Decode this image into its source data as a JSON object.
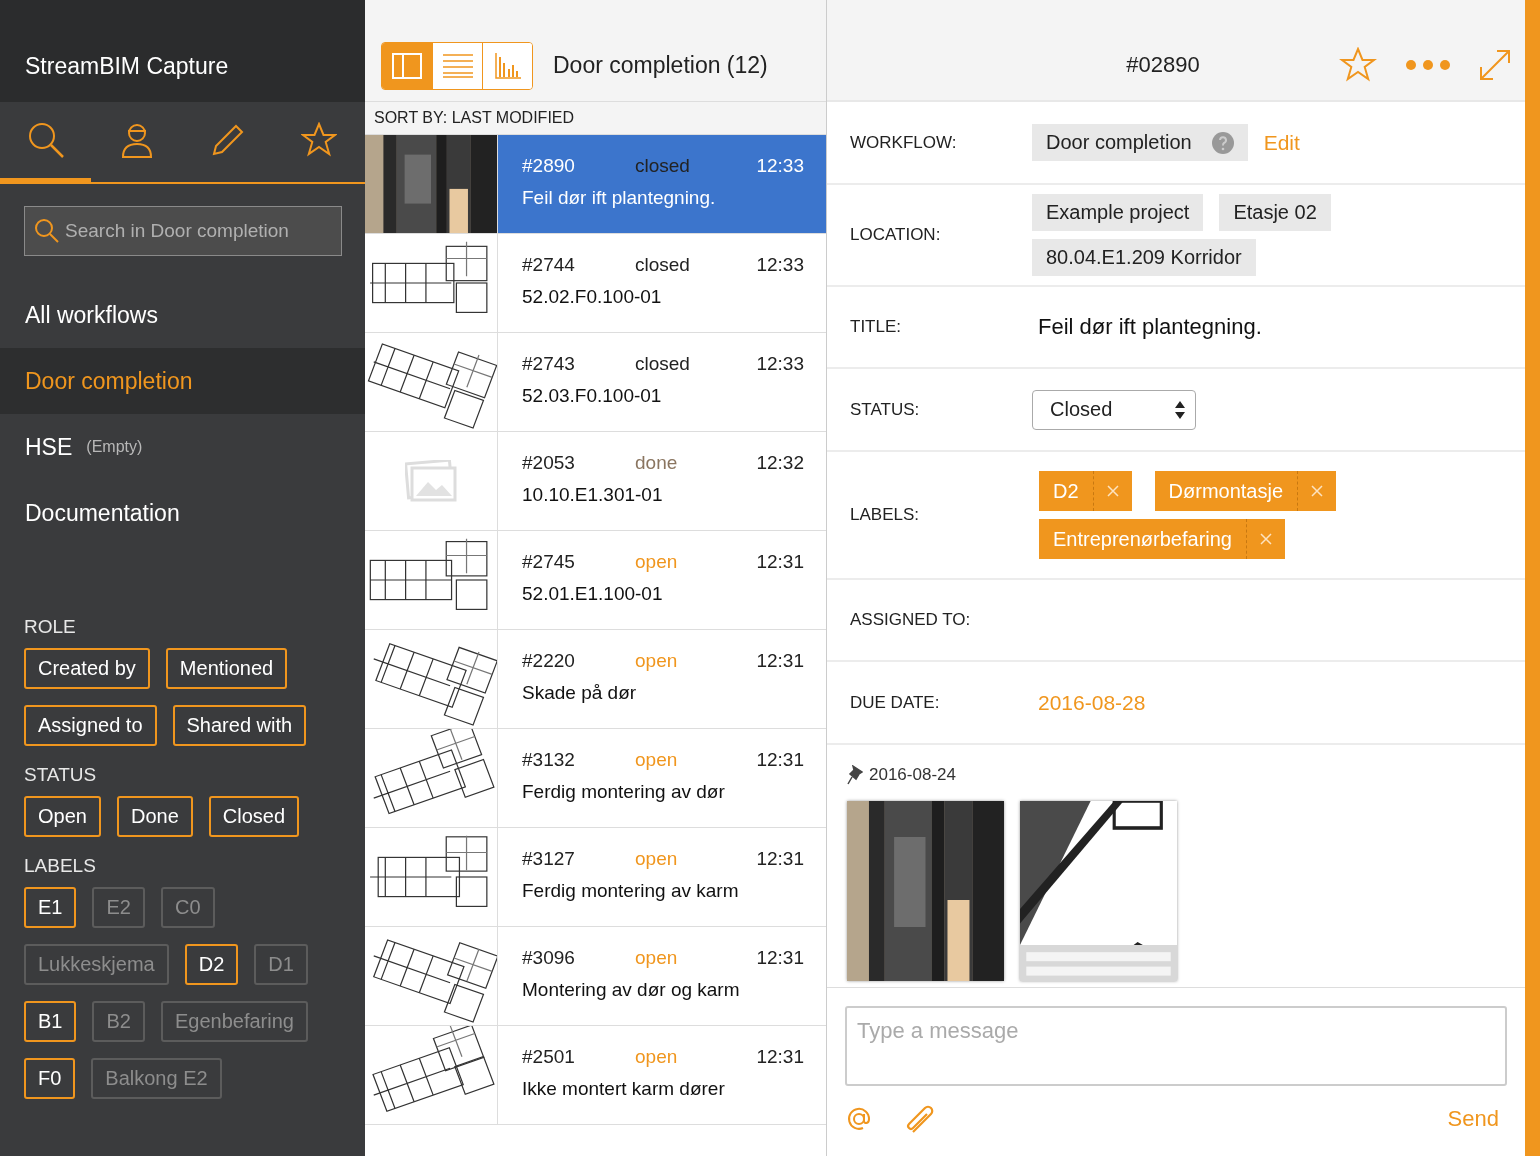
{
  "sidebar": {
    "title": "StreamBIM Capture",
    "tabs": [
      {
        "kind": "search",
        "selected": true
      },
      {
        "kind": "person",
        "selected": false
      },
      {
        "kind": "pencil",
        "selected": false
      },
      {
        "kind": "star",
        "selected": false
      }
    ],
    "search": {
      "placeholder": "Search in Door completion"
    },
    "workflows": [
      {
        "label": "All workflows",
        "selected": false
      },
      {
        "label": "Door completion",
        "selected": true
      },
      {
        "label": "HSE",
        "note": "(Empty)",
        "selected": false
      },
      {
        "label": "Documentation",
        "selected": false
      }
    ],
    "filters": [
      {
        "heading": "ROLE",
        "chips": [
          {
            "label": "Created by",
            "selected": true
          },
          {
            "label": "Mentioned",
            "selected": true
          },
          {
            "label": "Assigned to",
            "selected": true
          },
          {
            "label": "Shared with",
            "selected": true
          }
        ]
      },
      {
        "heading": "STATUS",
        "chips": [
          {
            "label": "Open",
            "selected": true
          },
          {
            "label": "Done",
            "selected": true
          },
          {
            "label": "Closed",
            "selected": true
          }
        ]
      },
      {
        "heading": "LABELS",
        "chips": [
          {
            "label": "E1",
            "selected": true
          },
          {
            "label": "E2",
            "selected": false
          },
          {
            "label": "C0",
            "selected": false
          },
          {
            "label": "Lukkeskjema",
            "selected": false
          },
          {
            "label": "D2",
            "selected": true
          },
          {
            "label": "D1",
            "selected": false
          },
          {
            "label": "B1",
            "selected": true
          },
          {
            "label": "B2",
            "selected": false
          },
          {
            "label": "Egenbefaring",
            "selected": false
          },
          {
            "label": "F0",
            "selected": true
          },
          {
            "label": "Balkong E2",
            "selected": false
          }
        ]
      }
    ]
  },
  "list": {
    "views": [
      {
        "kind": "split",
        "selected": true
      },
      {
        "kind": "lines",
        "selected": false
      },
      {
        "kind": "chart",
        "selected": false
      }
    ],
    "title": "Door completion (12)",
    "sort": "SORT BY: LAST MODIFIED",
    "rows": [
      {
        "id": "#2890",
        "status": "closed",
        "color": "#222222",
        "time": "12:33",
        "title": "Feil dør ift plantegning.",
        "selected": true
      },
      {
        "id": "#2744",
        "status": "closed",
        "color": "#222222",
        "time": "12:33",
        "title": "52.02.F0.100-01",
        "kind": "plan",
        "selected": false
      },
      {
        "id": "#2743",
        "status": "closed",
        "color": "#222222",
        "time": "12:33",
        "title": "52.03.F0.100-01",
        "kind": "plan",
        "selected": false
      },
      {
        "id": "#2053",
        "status": "done",
        "color": "#8a7560",
        "time": "12:32",
        "title": "10.10.E1.301-01",
        "kind": "none",
        "selected": false
      },
      {
        "id": "#2745",
        "status": "open",
        "color": "#f0961e",
        "time": "12:31",
        "title": "52.01.E1.100-01",
        "kind": "plan",
        "selected": false
      },
      {
        "id": "#2220",
        "status": "open",
        "color": "#f0961e",
        "time": "12:31",
        "title": "Skade på dør",
        "kind": "plan",
        "selected": false
      },
      {
        "id": "#3132",
        "status": "open",
        "color": "#f0961e",
        "time": "12:31",
        "title": "Ferdig montering av dør",
        "kind": "plan",
        "selected": false
      },
      {
        "id": "#3127",
        "status": "open",
        "color": "#f0961e",
        "time": "12:31",
        "title": "Ferdig montering av karm",
        "kind": "plan",
        "selected": false
      },
      {
        "id": "#3096",
        "status": "open",
        "color": "#f0961e",
        "time": "12:31",
        "title": "Montering av dør og karm",
        "kind": "plan",
        "selected": false
      },
      {
        "id": "#2501",
        "status": "open",
        "color": "#f0961e",
        "time": "12:31",
        "title": "Ikke montert karm dører",
        "kind": "plan",
        "selected": false
      }
    ]
  },
  "detail": {
    "number": "#02890",
    "fields": [
      {
        "kind": "workflow",
        "label": "WORKFLOW:",
        "chips": [
          "Door completion"
        ],
        "link": "Edit"
      },
      {
        "kind": "chips",
        "label": "LOCATION:",
        "chips": [
          "Example project",
          "Etasje 02",
          "80.04.E1.209 Korridor"
        ]
      },
      {
        "kind": "text",
        "label": "TITLE:",
        "value": "Feil dør ift plantegning."
      },
      {
        "kind": "select",
        "label": "STATUS:",
        "value": "Closed"
      },
      {
        "kind": "tags",
        "label": "LABELS:",
        "chips": [
          "D2",
          "Dørmontasje",
          "Entreprenørbefaring"
        ]
      },
      {
        "kind": "empty",
        "label": "ASSIGNED TO:"
      },
      {
        "kind": "date",
        "label": "DUE DATE:",
        "value": "2016-08-28"
      }
    ],
    "attachment": {
      "date": "2016-08-24"
    },
    "message": {
      "placeholder": "Type a message",
      "send": "Send"
    }
  }
}
